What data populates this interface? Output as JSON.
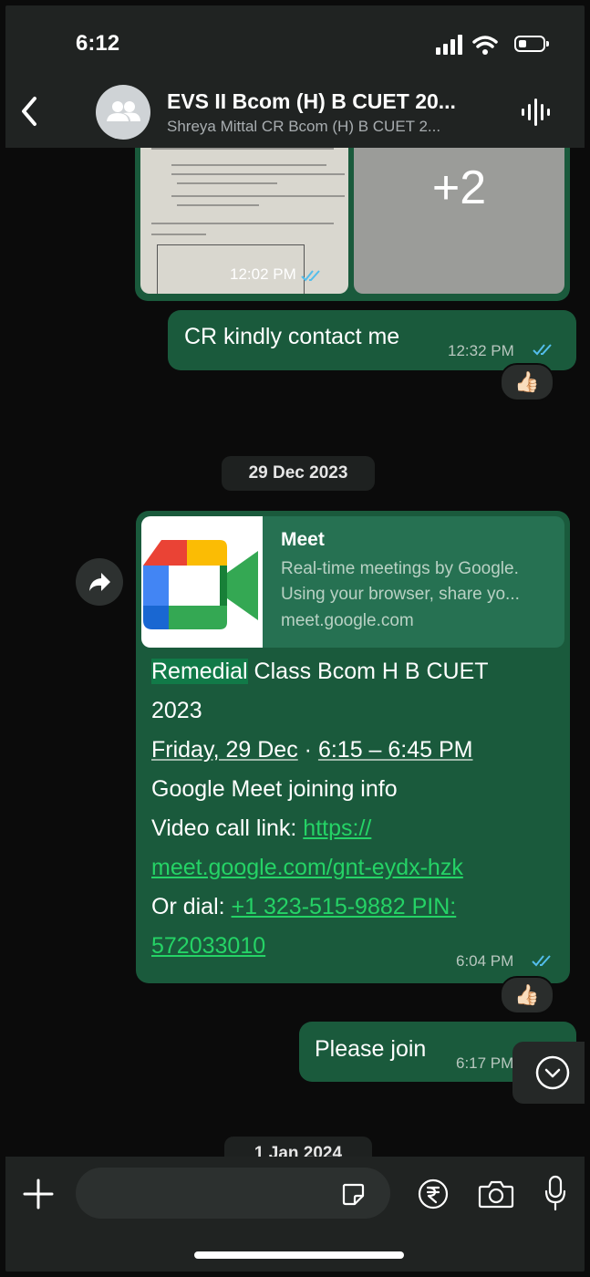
{
  "status_bar": {
    "time": "6:12"
  },
  "header": {
    "title": "EVS II Bcom (H) B CUET 20...",
    "subtitle": "Shreya Mittal CR Bcom (H) B CUET 2..."
  },
  "media_message": {
    "more_count": "+2",
    "time": "12:02 PM"
  },
  "messages": [
    {
      "text": "CR kindly contact me",
      "time": "12:32 PM",
      "reaction": "👍🏻"
    },
    {
      "text": "Please join",
      "time": "6:17 PM"
    }
  ],
  "dates": [
    "29 Dec 2023",
    "1 Jan 2024"
  ],
  "meet_message": {
    "preview_title": "Meet",
    "preview_desc_1": "Real-time meetings by Google.",
    "preview_desc_2": "Using your browser, share yo...",
    "preview_domain": "meet.google.com",
    "line1_highlight": "Remedial",
    "line1_rest": " Class Bcom H B CUET",
    "line2": "2023",
    "line3_date": "Friday, 29 Dec",
    "line3_sep": " · ",
    "line3_time": "6:15 – 6:45 PM",
    "line4": "Google Meet joining info",
    "line5_label": "Video call link: ",
    "line5_link": "https://",
    "line6_link": "meet.google.com/gnt-eydx-hzk",
    "line7_label": "Or dial: ",
    "line7_link": "+1 323-515-9882 PIN:",
    "line8_link": "572033010",
    "time": "6:04 PM",
    "reaction": "👍🏻"
  },
  "colors": {
    "bubble": "#1a5a3c",
    "link": "#25d366",
    "read_tick": "#53bdeb",
    "background": "#0b0b0b"
  }
}
